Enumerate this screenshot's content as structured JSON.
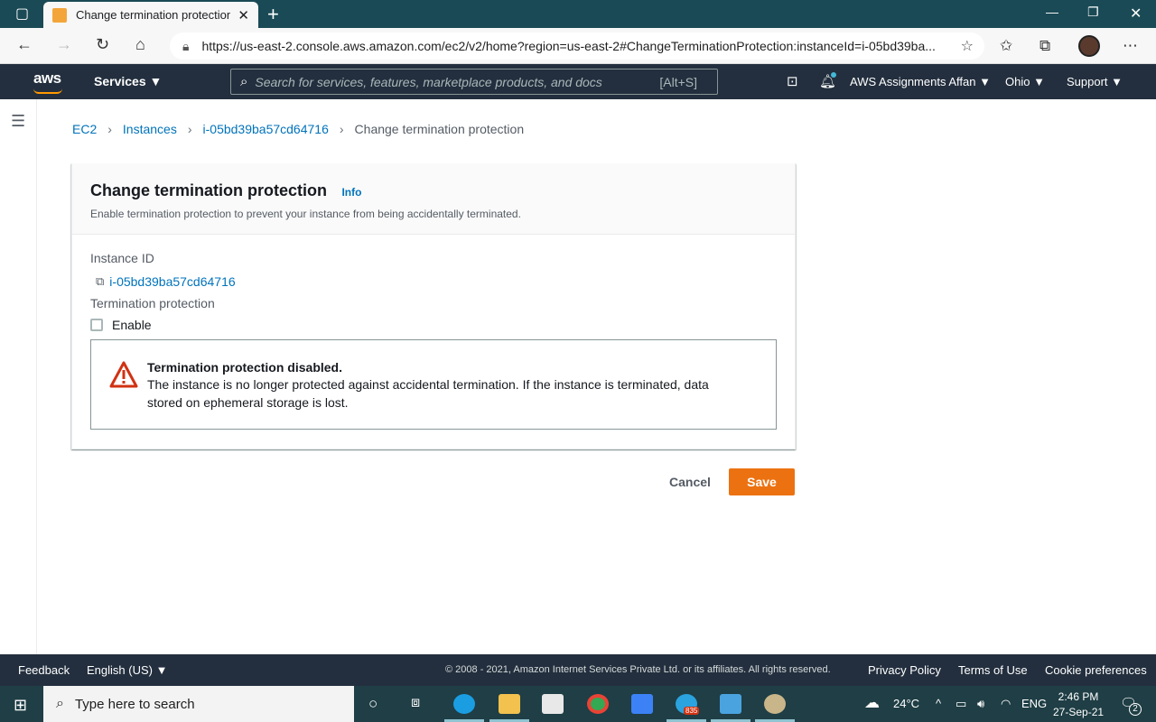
{
  "browser": {
    "tab_title": "Change termination protection |",
    "url": "https://us-east-2.console.aws.amazon.com/ec2/v2/home?region=us-east-2#ChangeTerminationProtection:instanceId=i-05bd39ba..."
  },
  "aws_header": {
    "logo": "aws",
    "services_label": "Services ▼",
    "search_placeholder": "Search for services, features, marketplace products, and docs",
    "search_shortcut": "[Alt+S]",
    "account": "AWS Assignments Affan ▼",
    "region": "Ohio ▼",
    "support": "Support ▼"
  },
  "breadcrumb": {
    "items": [
      "EC2",
      "Instances",
      "i-05bd39ba57cd64716"
    ],
    "current": "Change termination protection"
  },
  "panel": {
    "title": "Change termination protection",
    "info_link": "Info",
    "description": "Enable termination protection to prevent your instance from being accidentally terminated.",
    "instance_id_label": "Instance ID",
    "instance_id": "i-05bd39ba57cd64716",
    "termination_label": "Termination protection",
    "enable_label": "Enable",
    "enable_checked": false,
    "alert_title": "Termination protection disabled.",
    "alert_text": "The instance is no longer protected against accidental termination. If the instance is terminated, data stored on ephemeral storage is lost."
  },
  "actions": {
    "cancel_label": "Cancel",
    "save_label": "Save"
  },
  "footer": {
    "feedback": "Feedback",
    "language": "English (US) ▼",
    "copyright": "© 2008 - 2021, Amazon Internet Services Private Ltd. or its affiliates. All rights reserved.",
    "privacy": "Privacy Policy",
    "terms": "Terms of Use",
    "cookies": "Cookie preferences"
  },
  "taskbar": {
    "search_placeholder": "Type here to search",
    "temperature": "24°C",
    "language": "ENG",
    "time": "2:46 PM",
    "date": "27-Sep-21",
    "telegram_badge": "835",
    "notification_count": "2"
  },
  "colors": {
    "aws_dark": "#232f3e",
    "link_blue": "#0073bb",
    "save_orange": "#ec7211",
    "alert_red": "#d13212"
  }
}
